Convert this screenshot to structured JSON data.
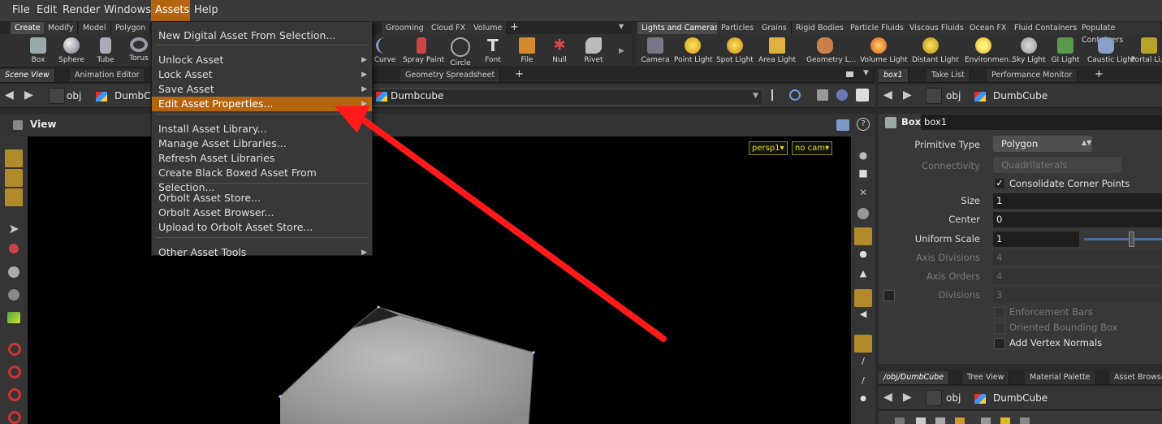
{
  "menubar": {
    "items": [
      "File",
      "Edit",
      "Render",
      "Windows",
      "Assets",
      "Help"
    ],
    "active": "Assets"
  },
  "shelf_left": {
    "tabs": [
      "Create",
      "Modify",
      "Model",
      "Polygon",
      "Grooming",
      "Cloud FX",
      "Volume"
    ],
    "tools": [
      "Box",
      "Sphere",
      "Tube",
      "Torus",
      "Curve",
      "Spray Paint",
      "Circle",
      "Font",
      "File",
      "Null",
      "Rivet"
    ]
  },
  "shelf_right": {
    "tabs": [
      "Lights and Cameras",
      "Particles",
      "Grains",
      "Rigid Bodies",
      "Particle Fluids",
      "Viscous Fluids",
      "Ocean FX",
      "Fluid Containers",
      "Populate Containers"
    ],
    "tools": [
      "Camera",
      "Point Light",
      "Spot Light",
      "Area Light",
      "Geometry L...",
      "Volume Light",
      "Distant Light",
      "Environmen...",
      "Sky Light",
      "GI Light",
      "Caustic Light",
      "Portal Li..."
    ]
  },
  "scene_tabs": [
    "Scene View",
    "Animation Editor",
    "Geometry Spreadsheet"
  ],
  "scene_path": {
    "root": "obj",
    "node": "DumbCube",
    "node2": "Dumbcube"
  },
  "view_label": "View",
  "camera": {
    "persp": "persp1▾",
    "cam": "no cam▾"
  },
  "dropdown": {
    "items": [
      {
        "label": "New Digital Asset From Selection...",
        "sub": false
      },
      {
        "sep": true
      },
      {
        "label": "Unlock Asset",
        "sub": true
      },
      {
        "label": "Lock Asset",
        "sub": true
      },
      {
        "label": "Save Asset",
        "sub": true
      },
      {
        "label": "Edit Asset Properties...",
        "sub": true,
        "highlight": true
      },
      {
        "sep": true
      },
      {
        "label": "Install Asset Library...",
        "sub": false
      },
      {
        "label": "Manage Asset Libraries...",
        "sub": false
      },
      {
        "label": "Refresh Asset Libraries",
        "sub": false
      },
      {
        "label": "Create Black Boxed Asset From Selection...",
        "sub": false
      },
      {
        "sep": true
      },
      {
        "label": "Orbolt Asset Store...",
        "sub": false
      },
      {
        "label": "Orbolt Asset Browser...",
        "sub": false
      },
      {
        "label": "Upload to Orbolt Asset Store...",
        "sub": false
      },
      {
        "sep": true
      },
      {
        "label": "Other Asset Tools",
        "sub": true
      }
    ]
  },
  "right_tabs": [
    "box1",
    "Take List",
    "Performance Monitor"
  ],
  "right_path": {
    "root": "obj",
    "node": "DumbCube"
  },
  "params": {
    "node_type": "Box",
    "node_name": "box1",
    "primitive_type_label": "Primitive Type",
    "primitive_type_value": "Polygon",
    "connectivity_label": "Connectivity",
    "connectivity_value": "Quadrilaterals",
    "consolidate_label": "Consolidate Corner Points",
    "size_label": "Size",
    "size_value": "1",
    "center_label": "Center",
    "center_value": "0",
    "uniform_scale_label": "Uniform Scale",
    "uniform_scale_value": "1",
    "axis_divisions_label": "Axis Divisions",
    "axis_divisions_value": "4",
    "axis_orders_label": "Axis Orders",
    "axis_orders_value": "4",
    "divisions_label": "Divisions",
    "divisions_value": "3",
    "enforcement_label": "Enforcement Bars",
    "oriented_label": "Oriented Bounding Box",
    "add_normals_label": "Add Vertex Normals"
  },
  "net_tabs": [
    "/obj/DumbCube",
    "Tree View",
    "Material Palette",
    "Asset Browser"
  ],
  "net_path": {
    "root": "obj",
    "node": "DumbCube"
  },
  "colors": {
    "accent": "#b5650f",
    "arrow": "#ff1a1a"
  }
}
